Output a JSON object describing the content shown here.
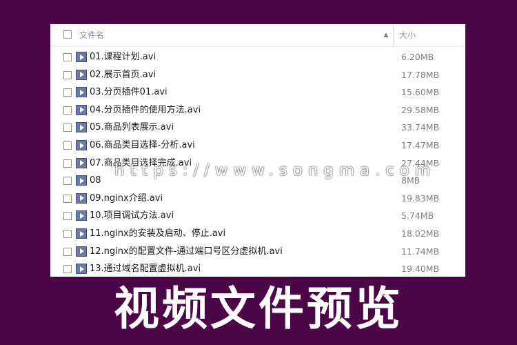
{
  "header": {
    "name_label": "文件名",
    "size_label": "大小",
    "sort_indicator": "▲"
  },
  "files": [
    {
      "name": "01.课程计划.avi",
      "size": "6.20MB"
    },
    {
      "name": "02.展示首页.avi",
      "size": "17.78MB"
    },
    {
      "name": "03.分页插件01.avi",
      "size": "15.60MB"
    },
    {
      "name": "04.分页插件的使用方法.avi",
      "size": "29.58MB"
    },
    {
      "name": "05.商品列表展示.avi",
      "size": "33.74MB"
    },
    {
      "name": "06.商品类目选择-分析.avi",
      "size": "17.47MB"
    },
    {
      "name": "07.商品类目选择完成.avi",
      "size": "27.44MB"
    },
    {
      "name": "08",
      "size": "8MB"
    },
    {
      "name": "09.nginx介绍.avi",
      "size": "19.83MB"
    },
    {
      "name": "10.项目调试方法.avi",
      "size": "5.74MB"
    },
    {
      "name": "11.nginx的安装及启动、停止.avi",
      "size": "18.02MB"
    },
    {
      "name": "12.nginx的配置文件-通过端口号区分虚拟机.avi",
      "size": "11.74MB"
    },
    {
      "name": "13.通过域名配置虚拟机.avi",
      "size": "19.40MB"
    }
  ],
  "watermark": "https://www.songma.com",
  "caption": "视频文件预览",
  "colors": {
    "background": "#4d0748",
    "panel": "#ffffff",
    "icon": "#6a7ba8"
  },
  "icons": {
    "file_icon": "video-file-icon",
    "checkbox": "checkbox-icon"
  }
}
